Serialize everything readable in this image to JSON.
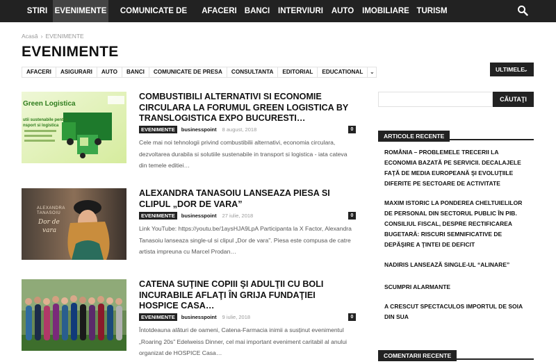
{
  "nav": {
    "items": [
      "STIRI",
      "EVENIMENTE",
      "COMUNICATE DE PRESA",
      "AFACERI",
      "BANCI",
      "INTERVIURI",
      "AUTO",
      "IMOBILIARE",
      "TURISM"
    ],
    "active": "EVENIMENTE",
    "search_icon": "search-icon"
  },
  "breadcrumb": {
    "home": "Acasă",
    "sep": "›",
    "current": "EVENIMENTE"
  },
  "page_title": "EVENIMENTE",
  "categories": [
    "AFACERI",
    "ASIGURARI",
    "AUTO",
    "BANCI",
    "COMUNICATE DE PRESA",
    "CONSULTANTA",
    "EDITORIAL",
    "EDUCATIONAL"
  ],
  "categories_more": "⌄",
  "sort": {
    "label": "ULTIMELE",
    "chevron": "⌄"
  },
  "articles": [
    {
      "title": "COMBUSTIBILI ALTERNATIVI SI ECONOMIE CIRCULARA LA FORUMUL GREEN LOGISTICA BY TRANSLOGISTICA EXPO BUCURESTI…",
      "category": "EVENIMENTE",
      "author": "businesspoint",
      "date": "8 august, 2018",
      "comments": "0",
      "excerpt": "Cele mai noi tehnologii privind combustibilii alternativi, economia circulara, dezvoltarea durabila si solutiile sustenabile in transport si logistica - iata cateva din temele editiei…",
      "thumb_text": [
        "Green Logistica",
        "utii sustenabile pentru",
        "nsport si logistica"
      ]
    },
    {
      "title": "ALEXANDRA TANASOIU LANSEAZA PIESA SI CLIPUL „DOR DE VARA”",
      "category": "EVENIMENTE",
      "author": "businesspoint",
      "date": "27 iulie, 2018",
      "comments": "0",
      "excerpt": "Link YouTube: https://youtu.be/1aysHJA9LpA     Participanta la X Factor, Alexandra Tanasoiu lanseaza single-ul si clipul „Dor de vara”. Piesa este compusa de catre artista impreuna cu Marcel Prodan…",
      "thumb_text": [
        "ALEXANDRA",
        "TANASOIU",
        "Dor de",
        "vara"
      ]
    },
    {
      "title": "CATENA SUŢINE COPIII ŞI ADULŢII CU BOLI INCURABILE AFLAŢI ÎN GRIJA FUNDAŢIEI HOSPICE CASA…",
      "category": "EVENIMENTE",
      "author": "businesspoint",
      "date": "9 iulie, 2018",
      "comments": "0",
      "excerpt": "Întotdeauna alături de oameni, Catena-Farmacia inimii a susținut evenimentul „Roaring 20s” Edelweiss Dinner, cel mai important eveniment caritabil al anului organizat de HOSPICE Casa…",
      "thumb_text": []
    }
  ],
  "sidebar": {
    "search_button": "CĂUTAŢI",
    "recent_heading": "ARTICOLE RECENTE",
    "recent": [
      "ROMÂNIA – PROBLEMELE TRECERII LA ECONOMIA BAZATĂ PE SERVICII. DECALAJELE FAŢĂ DE MEDIA EUROPEANĂ ŞI EVOLUŢIILE DIFERITE PE SECTOARE DE ACTIVITATE",
      "MAXIM ISTORIC LA PONDEREA CHELTUIELILOR DE PERSONAL DIN SECTORUL PUBLIC ÎN PIB. CONSILIUL FISCAL, DESPRE RECTIFICAREA BUGETARĂ: RISCURI SEMNIFICATIVE DE DEPĂŞIRE A ŢINTEI DE DEFICIT",
      "NADIRIS LANSEAZĂ SINGLE-UL “ALINARE”",
      "SCUMPRI ALARMANTE",
      "A CRESCUT SPECTACULOS IMPORTUL DE SOIA DIN SUA"
    ],
    "comments_heading": "COMENTARII RECENTE"
  }
}
